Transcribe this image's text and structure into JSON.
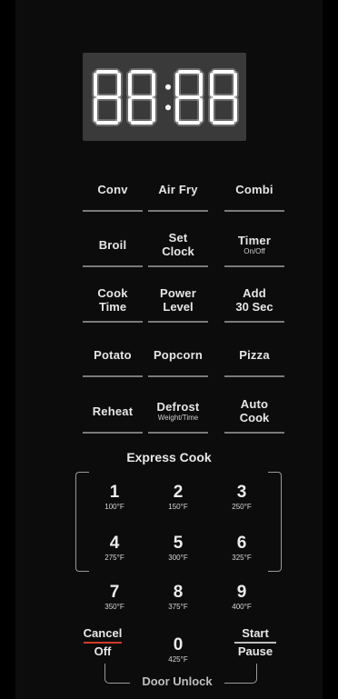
{
  "display": {
    "text": "88:88",
    "color": "#ffffff",
    "background": "#3a3a3a"
  },
  "function_keys": [
    {
      "id": "conv",
      "line1": "Conv",
      "line2": "",
      "sub": ""
    },
    {
      "id": "air-fry",
      "line1": "Air Fry",
      "line2": "",
      "sub": ""
    },
    {
      "id": "combi",
      "line1": "Combi",
      "line2": "",
      "sub": ""
    },
    {
      "id": "broil",
      "line1": "Broil",
      "line2": "",
      "sub": ""
    },
    {
      "id": "set-clock",
      "line1": "Set",
      "line2": "Clock",
      "sub": ""
    },
    {
      "id": "timer",
      "line1": "Timer",
      "line2": "",
      "sub": "On/Off"
    },
    {
      "id": "cook-time",
      "line1": "Cook",
      "line2": "Time",
      "sub": ""
    },
    {
      "id": "power-level",
      "line1": "Power",
      "line2": "Level",
      "sub": ""
    },
    {
      "id": "add-30-sec",
      "line1": "Add",
      "line2": "30 Sec",
      "sub": ""
    },
    {
      "id": "potato",
      "line1": "Potato",
      "line2": "",
      "sub": ""
    },
    {
      "id": "popcorn",
      "line1": "Popcorn",
      "line2": "",
      "sub": ""
    },
    {
      "id": "pizza",
      "line1": "Pizza",
      "line2": "",
      "sub": ""
    },
    {
      "id": "reheat",
      "line1": "Reheat",
      "line2": "",
      "sub": ""
    },
    {
      "id": "defrost",
      "line1": "Defrost",
      "line2": "",
      "sub": "Weight/Time"
    },
    {
      "id": "auto-cook",
      "line1": "Auto",
      "line2": "Cook",
      "sub": ""
    }
  ],
  "express_cook": {
    "label": "Express Cook"
  },
  "number_keys": [
    {
      "digit": "1",
      "temp": "100°F"
    },
    {
      "digit": "2",
      "temp": "150°F"
    },
    {
      "digit": "3",
      "temp": "250°F"
    },
    {
      "digit": "4",
      "temp": "275°F"
    },
    {
      "digit": "5",
      "temp": "300°F"
    },
    {
      "digit": "6",
      "temp": "325°F"
    },
    {
      "digit": "7",
      "temp": "350°F"
    },
    {
      "digit": "8",
      "temp": "375°F"
    },
    {
      "digit": "9",
      "temp": "400°F"
    },
    {
      "digit": "0",
      "temp": "425°F"
    }
  ],
  "cancel": {
    "line1": "Cancel",
    "line2": "Off",
    "accent": "#d23a2a"
  },
  "start": {
    "line1": "Start",
    "line2": "Pause"
  },
  "door_unlock": {
    "label": "Door Unlock"
  }
}
